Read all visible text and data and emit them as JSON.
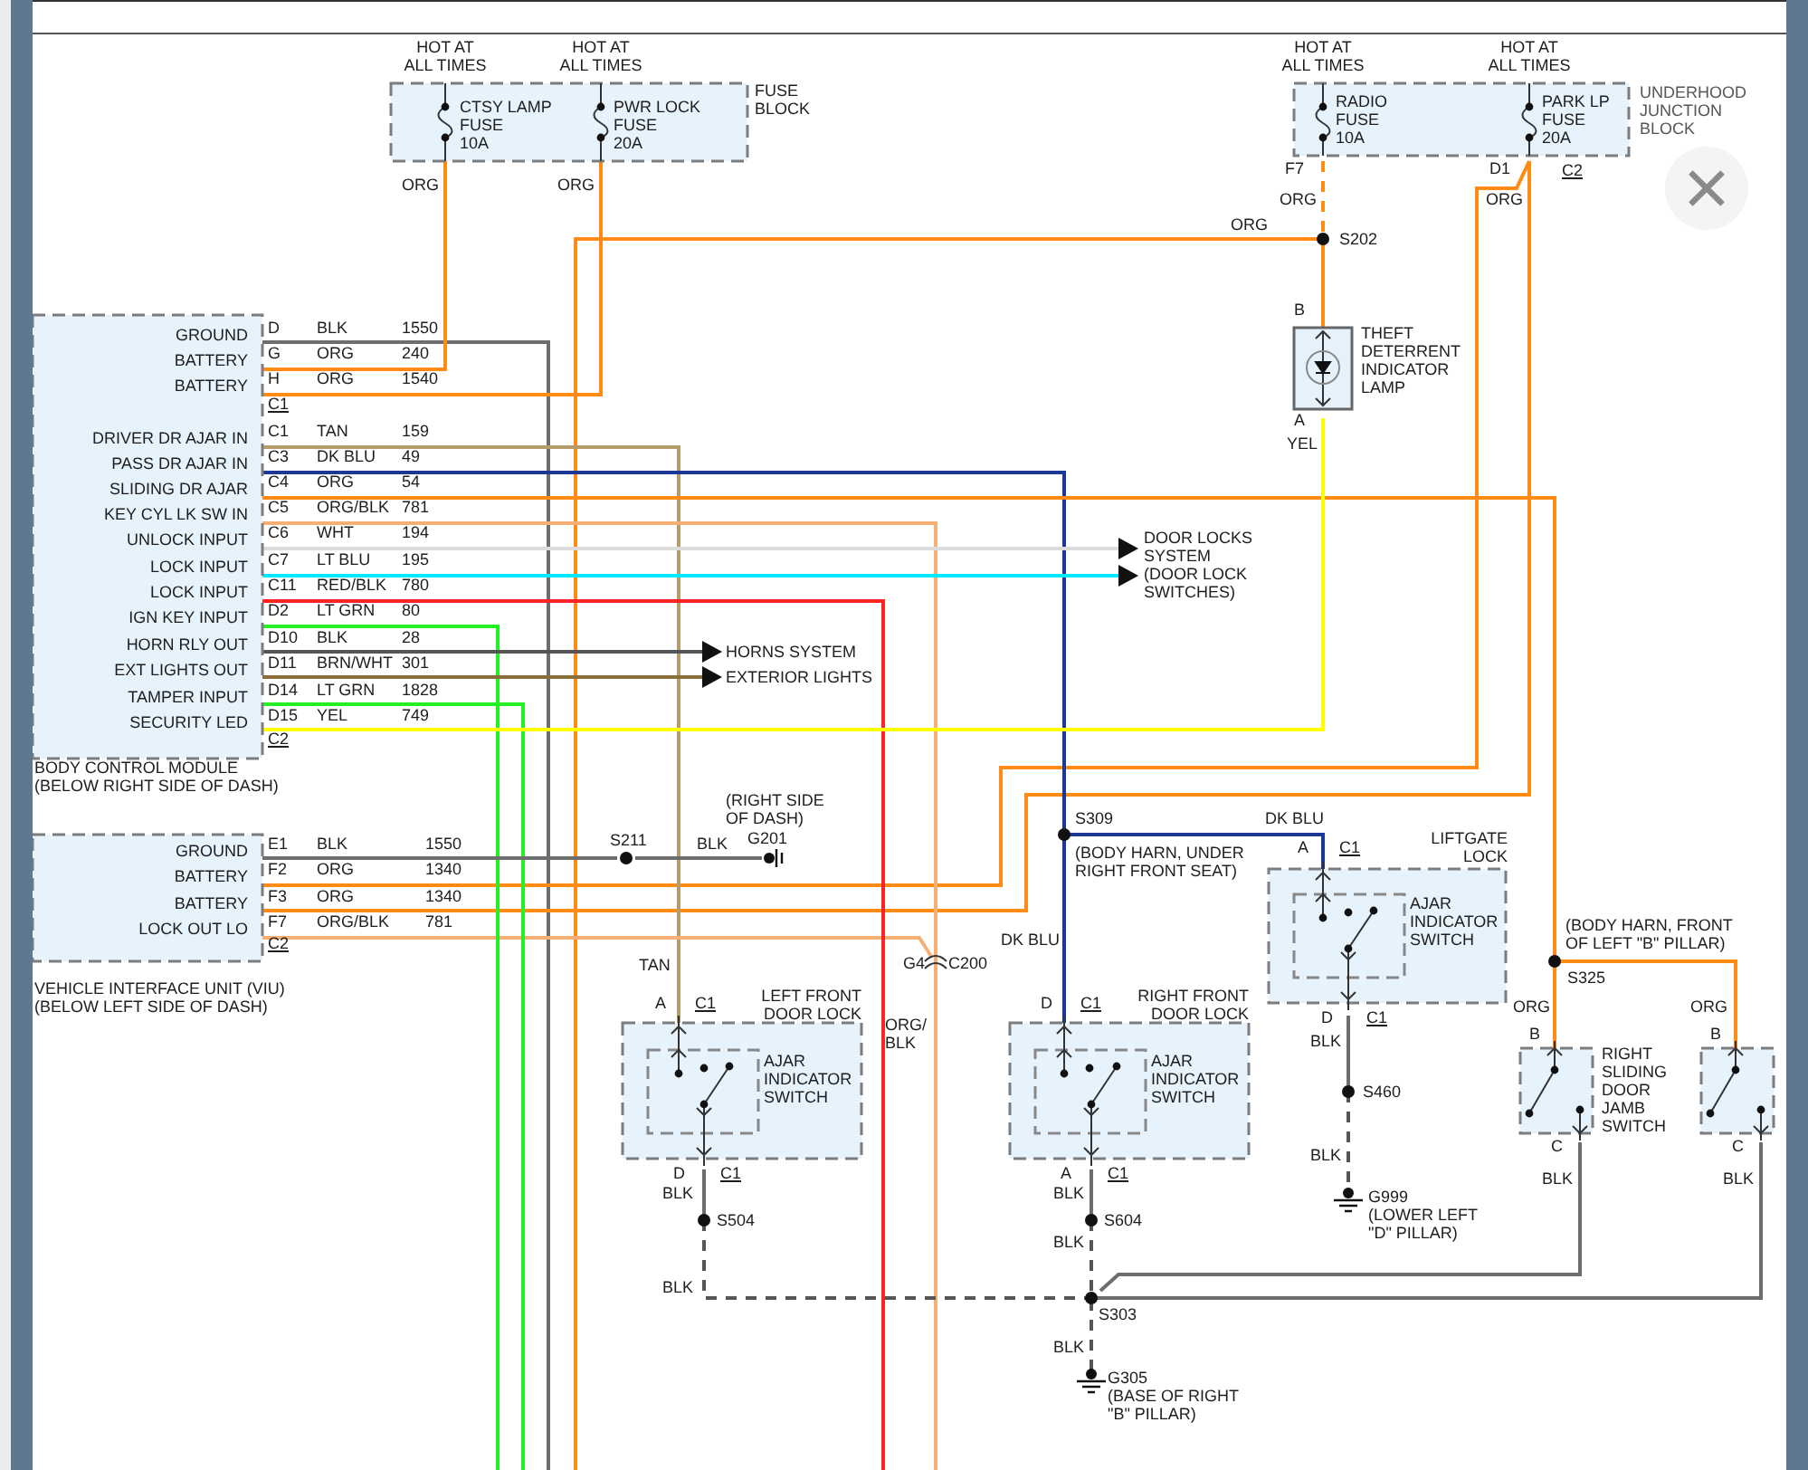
{
  "fuse_blocks": [
    {
      "name": "FUSE\nBLOCK",
      "fuses": [
        {
          "feed": "HOT AT\nALL TIMES",
          "label": "CTSY LAMP\nFUSE\n10A",
          "wire": "ORG"
        },
        {
          "feed": "HOT AT\nALL TIMES",
          "label": "PWR LOCK\nFUSE\n20A",
          "wire": "ORG"
        }
      ]
    },
    {
      "name": "UNDERHOOD\nJUNCTION\nBLOCK",
      "connector": "C2",
      "fuses": [
        {
          "feed": "HOT AT\nALL TIMES",
          "label": "RADIO\nFUSE\n10A",
          "pin": "F7",
          "wire": "ORG"
        },
        {
          "feed": "HOT AT\nALL TIMES",
          "label": "PARK LP\nFUSE\n20A",
          "pin": "D1",
          "wire": "ORG"
        }
      ]
    }
  ],
  "modules": [
    {
      "name": "BODY CONTROL MODULE\n(BELOW RIGHT SIDE OF DASH)",
      "rows": [
        {
          "kind": "pin",
          "label": "GROUND",
          "pin": "D",
          "wire": "BLK",
          "circuit": "1550"
        },
        {
          "kind": "pin",
          "label": "BATTERY",
          "pin": "G",
          "wire": "ORG",
          "circuit": "240"
        },
        {
          "kind": "pin",
          "label": "BATTERY",
          "pin": "H",
          "wire": "ORG",
          "circuit": "1540"
        },
        {
          "kind": "connector",
          "pin": "C1"
        },
        {
          "kind": "pin",
          "label": "DRIVER DR AJAR IN",
          "pin": "C1",
          "wire": "TAN",
          "circuit": "159"
        },
        {
          "kind": "pin",
          "label": "PASS DR AJAR IN",
          "pin": "C3",
          "wire": "DK BLU",
          "circuit": "49"
        },
        {
          "kind": "pin",
          "label": "SLIDING DR AJAR",
          "pin": "C4",
          "wire": "ORG",
          "circuit": "54"
        },
        {
          "kind": "pin",
          "label": "KEY CYL LK SW IN",
          "pin": "C5",
          "wire": "ORG/BLK",
          "circuit": "781"
        },
        {
          "kind": "pin",
          "label": "UNLOCK INPUT",
          "pin": "C6",
          "wire": "WHT",
          "circuit": "194"
        },
        {
          "kind": "pin",
          "label": "LOCK INPUT",
          "pin": "C7",
          "wire": "LT BLU",
          "circuit": "195"
        },
        {
          "kind": "pin",
          "label": "LOCK INPUT",
          "pin": "C11",
          "wire": "RED/BLK",
          "circuit": "780"
        },
        {
          "kind": "pin",
          "label": "IGN KEY INPUT",
          "pin": "D2",
          "wire": "LT GRN",
          "circuit": "80"
        },
        {
          "kind": "pin",
          "label": "HORN RLY OUT",
          "pin": "D10",
          "wire": "BLK",
          "circuit": "28"
        },
        {
          "kind": "pin",
          "label": "EXT LIGHTS OUT",
          "pin": "D11",
          "wire": "BRN/WHT",
          "circuit": "301"
        },
        {
          "kind": "pin",
          "label": "TAMPER INPUT",
          "pin": "D14",
          "wire": "LT GRN",
          "circuit": "1828"
        },
        {
          "kind": "pin",
          "label": "SECURITY LED",
          "pin": "D15",
          "wire": "YEL",
          "circuit": "749"
        },
        {
          "kind": "connector",
          "pin": "C2"
        }
      ]
    },
    {
      "name": "VEHICLE INTERFACE UNIT (VIU)\n(BELOW LEFT SIDE OF DASH)",
      "rows": [
        {
          "kind": "pin",
          "label": "GROUND",
          "pin": "E1",
          "wire": "BLK",
          "circuit": "1550"
        },
        {
          "kind": "pin",
          "label": "BATTERY",
          "pin": "F2",
          "wire": "ORG",
          "circuit": "1340"
        },
        {
          "kind": "pin",
          "label": "BATTERY",
          "pin": "F3",
          "wire": "ORG",
          "circuit": "1340"
        },
        {
          "kind": "pin",
          "label": "LOCK OUT LO",
          "pin": "F7",
          "wire": "ORG/BLK",
          "circuit": "781"
        },
        {
          "kind": "connector",
          "pin": "C2"
        }
      ]
    }
  ],
  "lamp": {
    "name": "THEFT\nDETERRENT\nINDICATOR\nLAMP",
    "pin_top": "B",
    "pin_bottom": "A",
    "wire_below": "YEL"
  },
  "systems": [
    {
      "label": "DOOR LOCKS\nSYSTEM\n(DOOR LOCK\nSWITCHES)"
    },
    {
      "label": "HORNS SYSTEM"
    },
    {
      "label": "EXTERIOR LIGHTS"
    }
  ],
  "splices": [
    {
      "name": "S202"
    },
    {
      "name": "S211"
    },
    {
      "name": "S309",
      "note": "(BODY HARN, UNDER\nRIGHT FRONT SEAT)"
    },
    {
      "name": "S325",
      "note": "(BODY HARN, FRONT\nOF LEFT \"B\" PILLAR)"
    },
    {
      "name": "S460"
    },
    {
      "name": "S504"
    },
    {
      "name": "S604"
    },
    {
      "name": "S303"
    }
  ],
  "grounds": [
    {
      "name": "G201",
      "note": "(RIGHT SIDE\nOF DASH)"
    },
    {
      "name": "G999",
      "note": "(LOWER LEFT\n\"D\" PILLAR)"
    },
    {
      "name": "G305",
      "note": "(BASE OF RIGHT\n\"B\" PILLAR)"
    }
  ],
  "inline_connectors": [
    {
      "cavity": "G4",
      "name": "C200"
    }
  ],
  "switches": [
    {
      "kind": "lock",
      "name": "LEFT FRONT\nDOOR LOCK",
      "switch": "AJAR\nINDICATOR\nSWITCH",
      "pin_top": "A",
      "conn_top": "C1",
      "pin_bottom": "D",
      "conn_bottom": "C1"
    },
    {
      "kind": "lock",
      "name": "RIGHT FRONT\nDOOR LOCK",
      "switch": "AJAR\nINDICATOR\nSWITCH",
      "pin_top": "D",
      "conn_top": "C1",
      "pin_bottom": "A",
      "conn_bottom": "C1"
    },
    {
      "kind": "lock",
      "name": "LIFTGATE\nLOCK",
      "switch": "AJAR\nINDICATOR\nSWITCH",
      "pin_top": "A",
      "conn_top": "C1",
      "pin_bottom": "D",
      "conn_bottom": "C1"
    },
    {
      "kind": "jamb",
      "name": "RIGHT\nSLIDING\nDOOR\nJAMB\nSWITCH",
      "pin_top": "B",
      "pin_bottom": "C"
    },
    {
      "kind": "jamb",
      "pin_top": "B",
      "pin_bottom": "C"
    }
  ],
  "wire_labels": [
    "ORG",
    "DK BLU",
    "BLK",
    "DK BLU",
    "ORG/\nBLK",
    "TAN",
    "BLK",
    "BLK",
    "BLK",
    "BLK",
    "BLK",
    "BLK",
    "BLK",
    "ORG",
    "ORG",
    "BLK",
    "BLK"
  ]
}
